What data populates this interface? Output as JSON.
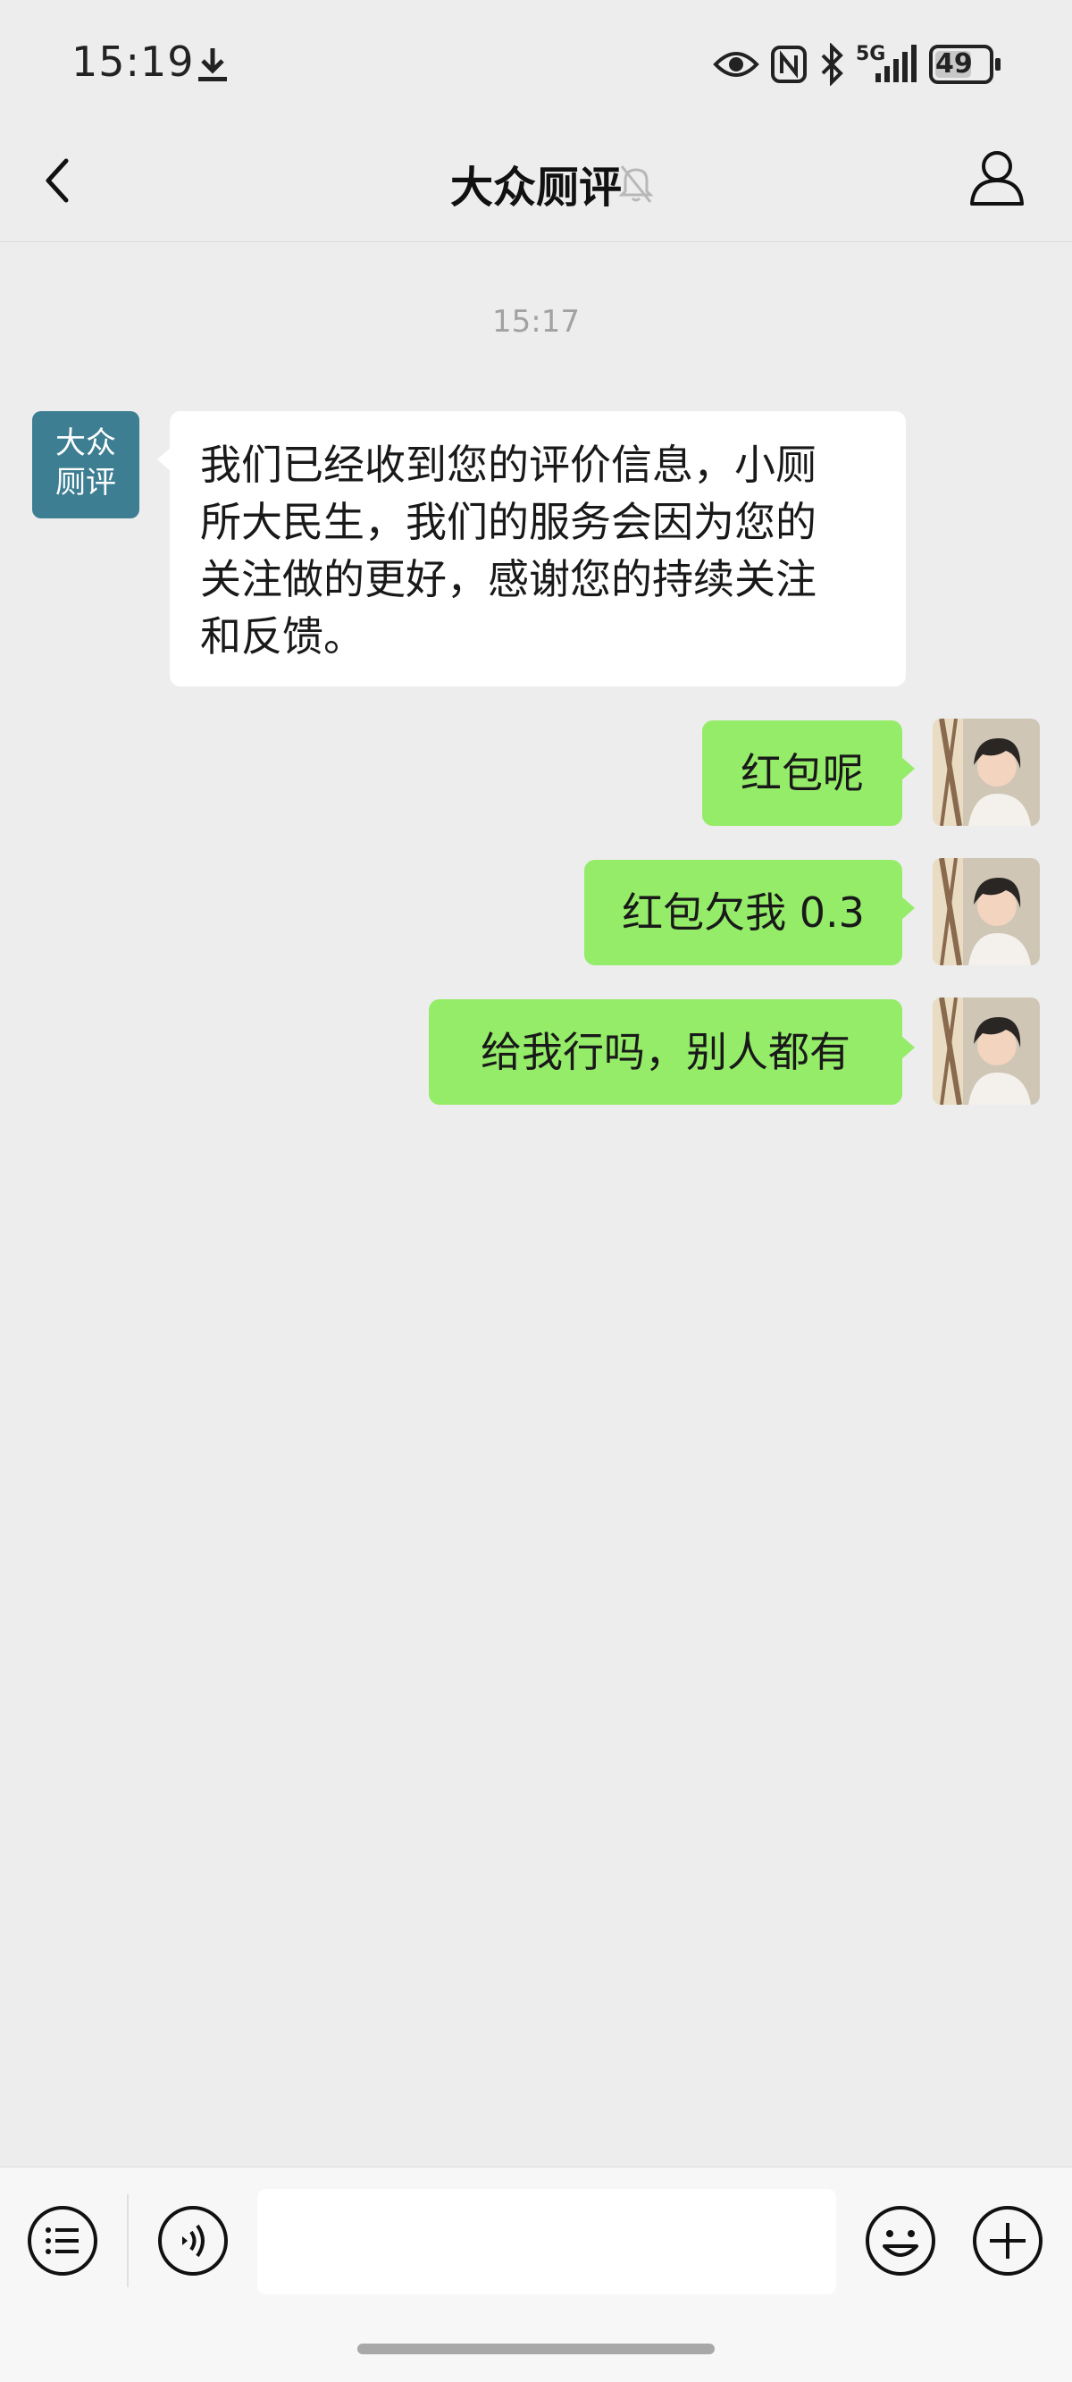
{
  "status_bar": {
    "time": "15:19",
    "signal_label": "5G",
    "battery": "49",
    "icons": [
      "download-icon",
      "eye-icon",
      "nfc-icon",
      "bluetooth-icon",
      "signal-icon",
      "battery-icon"
    ]
  },
  "header": {
    "title": "大众厕评",
    "icons": [
      "back-icon",
      "mute-bell-icon",
      "profile-icon"
    ]
  },
  "chat": {
    "timestamp": "15:17",
    "bot_avatar_text": [
      "大众",
      "厕评"
    ],
    "messages": [
      {
        "side": "in",
        "lines": [
          "我们已经收到您的评价信息，小厕",
          "所大民生，我们的服务会因为您的",
          "关注做的更好，感谢您的持续关注",
          "和反馈。"
        ]
      },
      {
        "side": "out",
        "text": "红包呢"
      },
      {
        "side": "out",
        "text": "红包欠我 0.3"
      },
      {
        "side": "out",
        "text": "给我行吗，别人都有"
      }
    ]
  },
  "input_bar": {
    "value": "",
    "icons": [
      "menu-list-icon",
      "voice-icon",
      "emoji-icon",
      "plus-icon"
    ]
  },
  "colors": {
    "background": "#ededed",
    "outgoing_bubble": "#95ec69",
    "incoming_bubble": "#ffffff",
    "bot_avatar": "#3d7e93"
  }
}
